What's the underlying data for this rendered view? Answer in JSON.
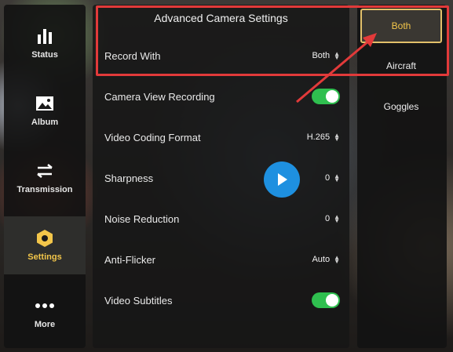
{
  "sidebar": {
    "items": [
      {
        "label": "Status",
        "icon": "bar-chart-icon"
      },
      {
        "label": "Album",
        "icon": "image-icon"
      },
      {
        "label": "Transmission",
        "icon": "swap-icon"
      },
      {
        "label": "Settings",
        "icon": "hexagon-gear-icon",
        "active": true
      },
      {
        "label": "More",
        "icon": "more-dots-icon"
      }
    ]
  },
  "panel": {
    "title": "Advanced Camera Settings",
    "rows": [
      {
        "label": "Record With",
        "value": "Both"
      },
      {
        "label": "Camera View Recording",
        "toggle": true
      },
      {
        "label": "Video Coding Format",
        "value": "H.265"
      },
      {
        "label": "Sharpness",
        "value": "0"
      },
      {
        "label": "Noise Reduction",
        "value": "0"
      },
      {
        "label": "Anti-Flicker",
        "value": "Auto"
      },
      {
        "label": "Video Subtitles",
        "toggle": true
      }
    ]
  },
  "options": {
    "items": [
      {
        "label": "Both",
        "selected": true
      },
      {
        "label": "Aircraft"
      },
      {
        "label": "Goggles"
      }
    ]
  },
  "colors": {
    "accent": "#f3c64a",
    "highlight": "#e23a3a",
    "toggle_on": "#2fbf4f",
    "play": "#1e90e0"
  }
}
